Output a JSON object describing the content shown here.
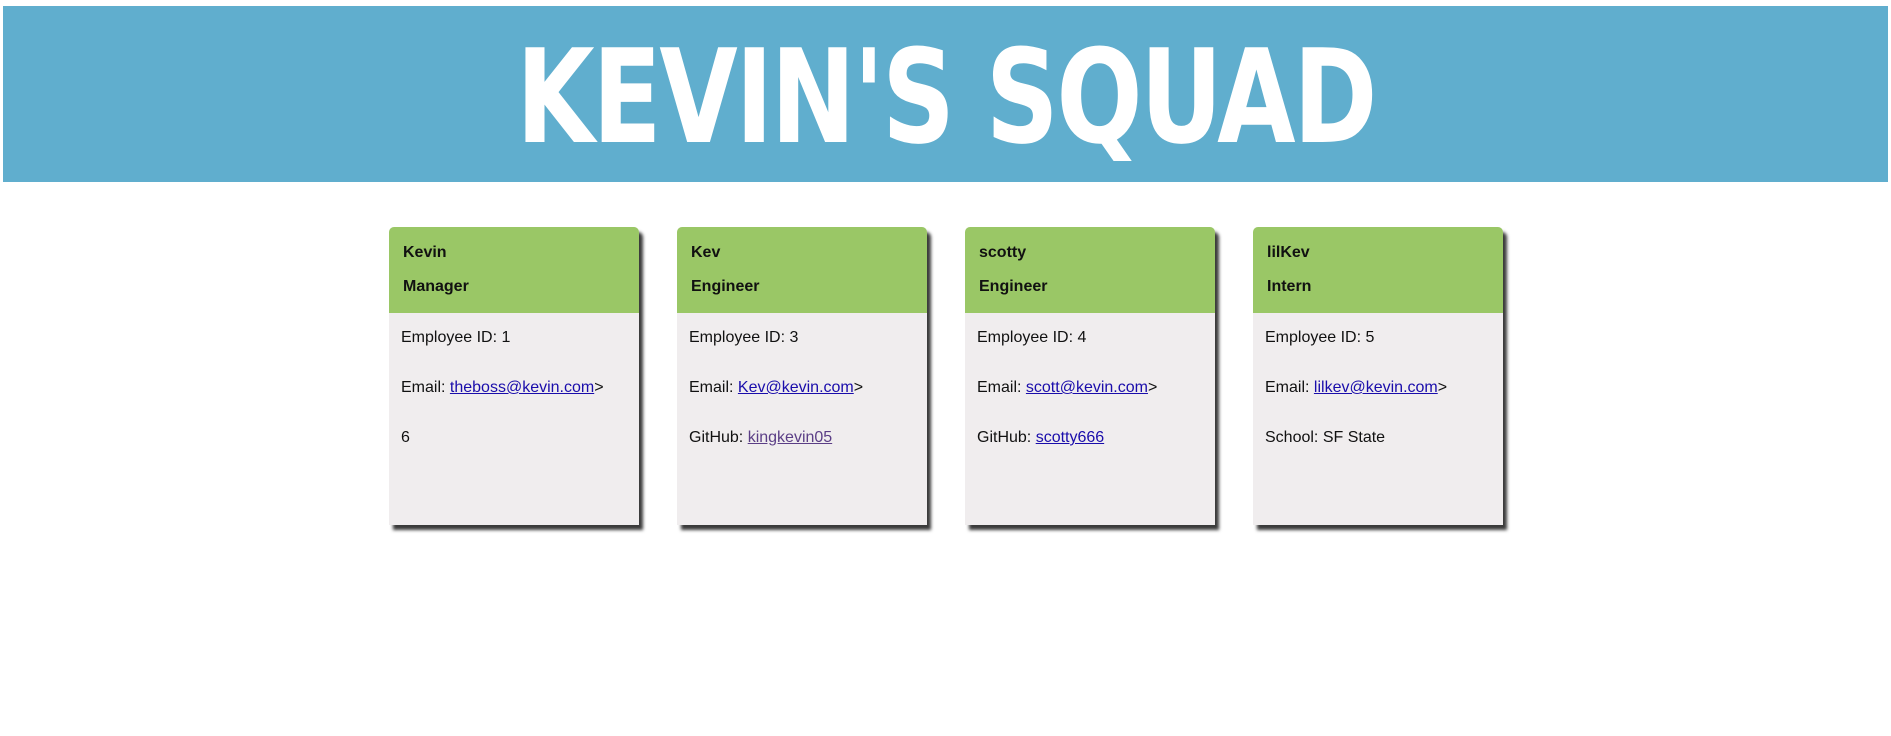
{
  "header": {
    "title": "KEVIN'S SQUAD"
  },
  "colors": {
    "banner": "#60aece",
    "card_header": "#9ac766",
    "card_body": "#f0edee",
    "link": "#1a0dab"
  },
  "cards": [
    {
      "name": "Kevin",
      "role": "Manager",
      "id_text": "Employee ID: 1",
      "email_label": "Email: ",
      "email": "theboss@kevin.com",
      "email_suffix": ">",
      "extra_label": "",
      "extra_value": "6"
    },
    {
      "name": "Kev",
      "role": "Engineer",
      "id_text": "Employee ID: 3",
      "email_label": "Email: ",
      "email": "Kev@kevin.com",
      "email_suffix": ">",
      "extra_label": "GitHub: ",
      "extra_value": "kingkevin05"
    },
    {
      "name": "scotty",
      "role": "Engineer",
      "id_text": "Employee ID: 4",
      "email_label": "Email: ",
      "email": "scott@kevin.com",
      "email_suffix": ">",
      "extra_label": "GitHub: ",
      "extra_value": "scotty666"
    },
    {
      "name": "lilKev",
      "role": "Intern",
      "id_text": "Employee ID: 5",
      "email_label": "Email: ",
      "email": "lilkev@kevin.com",
      "email_suffix": ">",
      "extra_label": "School: ",
      "extra_value": "SF State"
    }
  ]
}
